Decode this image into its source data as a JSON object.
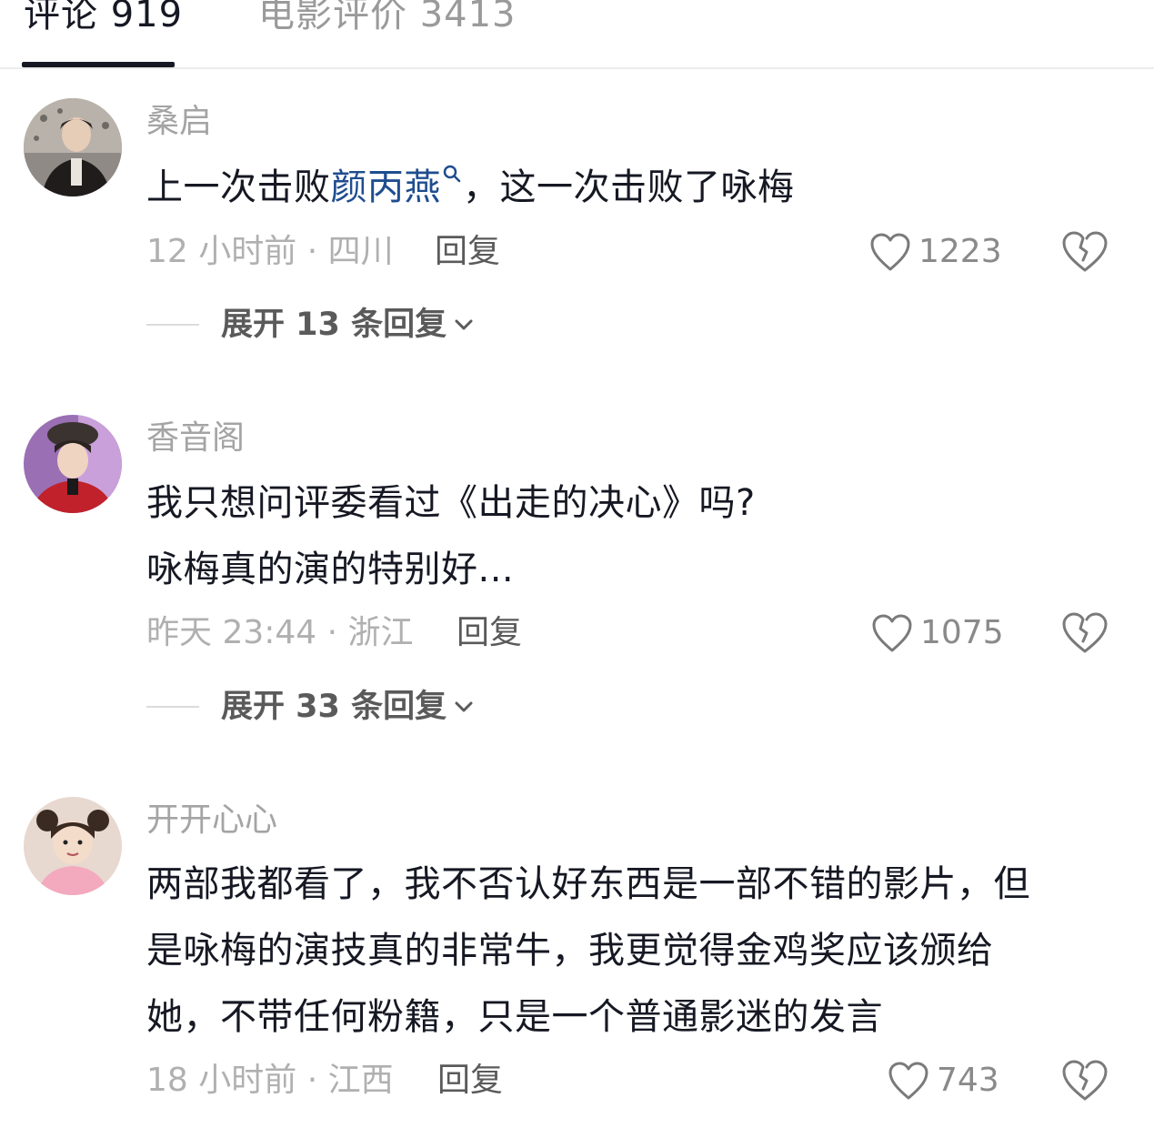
{
  "tabs": [
    {
      "label": "评论 919",
      "active": true
    },
    {
      "label": "电影评价 3413",
      "active": false
    }
  ],
  "comments": [
    {
      "username": "桑启",
      "text_lines": [
        "上一次击败",
        "颜丙燕",
        "，这一次击败了咏梅"
      ],
      "meta": "12 小时前 · 四川",
      "reply_label": "回复",
      "likes": "1223",
      "expand_label": "展开 13 条回复"
    },
    {
      "username": "香音阁",
      "text_lines": [
        "我只想问评委看过《出走的决心》吗?",
        "咏梅真的演的特别好..."
      ],
      "meta": "昨天 23:44 · 浙江",
      "reply_label": "回复",
      "likes": "1075",
      "expand_label": "展开 33 条回复"
    },
    {
      "username": "开开心心",
      "text_lines": [
        "两部我都看了，我不否认好东西是一部不错的影片，但",
        "是咏梅的演技真的非常牛，我更觉得金鸡奖应该颁给",
        "她，不带任何粉籍，只是一个普通影迷的发言"
      ],
      "meta": "18 小时前 · 江西",
      "reply_label": "回复",
      "likes": "743"
    }
  ],
  "colors": {
    "primary_text": "#161823",
    "secondary_text": "#a4a4a4",
    "link": "#1f4d8f",
    "divider": "#ececec"
  },
  "icons": {
    "like": "heart-outline-icon",
    "dislike": "broken-heart-icon",
    "expand": "chevron-down-icon",
    "link": "search-icon"
  }
}
